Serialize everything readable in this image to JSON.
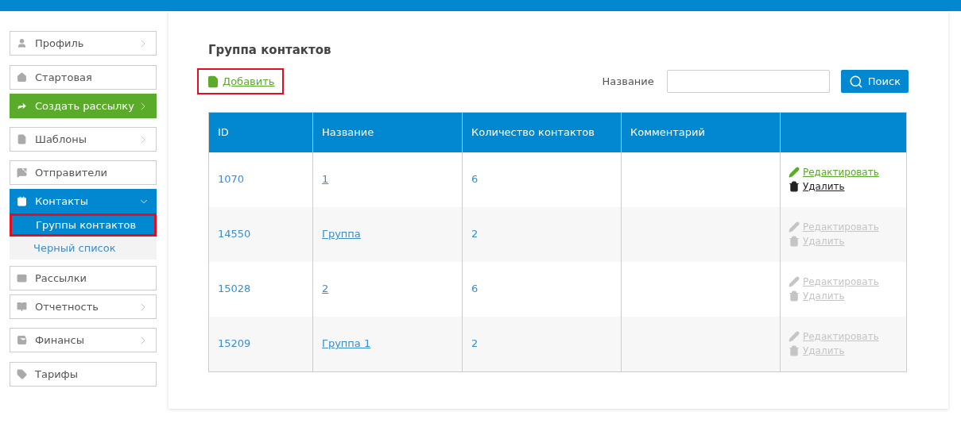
{
  "sidebar": {
    "items": [
      {
        "label": "Профиль",
        "kind": "submenu"
      },
      {
        "label": "Стартовая",
        "kind": "plain"
      },
      {
        "label": "Создать рассылку",
        "kind": "primary"
      },
      {
        "label": "Шаблоны",
        "kind": "submenu"
      },
      {
        "label": "Отправители",
        "kind": "plain"
      },
      {
        "label": "Контакты",
        "kind": "group",
        "expanded": true,
        "children": [
          {
            "label": "Группы контактов",
            "selected": true,
            "highlighted": true
          },
          {
            "label": "Черный список",
            "selected": false,
            "highlighted": false
          }
        ]
      },
      {
        "label": "Рассылки",
        "kind": "plain"
      },
      {
        "label": "Отчетность",
        "kind": "submenu"
      },
      {
        "label": "Финансы",
        "kind": "submenu"
      },
      {
        "label": "Тарифы",
        "kind": "plain"
      }
    ]
  },
  "main": {
    "title": "Группа контактов",
    "add_link": {
      "label": "Добавить",
      "highlighted": true
    },
    "search": {
      "label": "Название",
      "button": "Поиск"
    },
    "table": {
      "columns": [
        "ID",
        "Название",
        "Количество контактов",
        "Комментарий"
      ],
      "rows": [
        {
          "id": "1070",
          "name": "1",
          "count": "6",
          "actions_enabled": true,
          "edit": "Редактировать",
          "delete": "Удалить"
        },
        {
          "id": "14550",
          "name": "Группа",
          "count": "2",
          "actions_enabled": false,
          "edit": "Редактировать",
          "delete": "Удалить"
        },
        {
          "id": "15028",
          "name": "2",
          "count": "6",
          "actions_enabled": false,
          "edit": "Редактировать",
          "delete": "Удалить"
        },
        {
          "id": "15209",
          "name": "Группа 1",
          "count": "2",
          "actions_enabled": false,
          "edit": "Редактировать",
          "delete": "Удалить"
        }
      ]
    }
  }
}
